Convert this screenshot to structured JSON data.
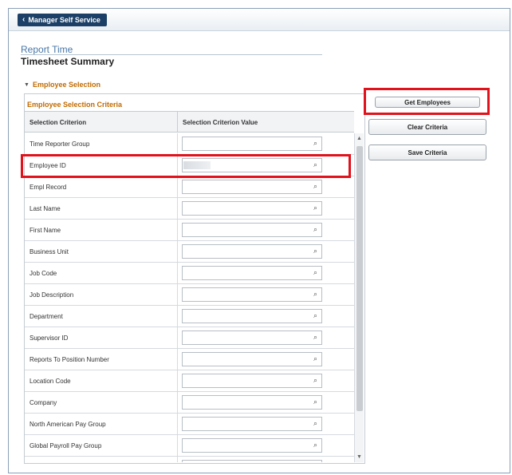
{
  "nav": {
    "back_label": "Manager Self Service"
  },
  "header": {
    "breadcrumb": "Report Time",
    "title": "Timesheet Summary"
  },
  "section": {
    "label": "Employee Selection",
    "grid_title": "Employee Selection Criteria"
  },
  "grid": {
    "columns": [
      "Selection Criterion",
      "Selection Criterion Value"
    ],
    "rows": [
      {
        "label": "Time Reporter Group",
        "value": ""
      },
      {
        "label": "Employee ID",
        "value": ""
      },
      {
        "label": "Empl Record",
        "value": ""
      },
      {
        "label": "Last Name",
        "value": ""
      },
      {
        "label": "First Name",
        "value": ""
      },
      {
        "label": "Business Unit",
        "value": ""
      },
      {
        "label": "Job Code",
        "value": ""
      },
      {
        "label": "Job Description",
        "value": ""
      },
      {
        "label": "Department",
        "value": ""
      },
      {
        "label": "Supervisor ID",
        "value": ""
      },
      {
        "label": "Reports To Position Number",
        "value": ""
      },
      {
        "label": "Location Code",
        "value": ""
      },
      {
        "label": "Company",
        "value": ""
      },
      {
        "label": "North American Pay Group",
        "value": ""
      },
      {
        "label": "Global Payroll Pay Group",
        "value": ""
      },
      {
        "label": "",
        "value": ""
      }
    ]
  },
  "actions": {
    "get_employees": "Get Employees",
    "clear_criteria": "Clear Criteria",
    "save_criteria": "Save Criteria"
  },
  "icons": {
    "lookup": "magnifier-icon",
    "back": "chevron-left-icon"
  },
  "colors": {
    "nav": "#1b3f66",
    "section": "#c06a00",
    "highlight": "#e0121c",
    "link": "#4a78a8"
  }
}
